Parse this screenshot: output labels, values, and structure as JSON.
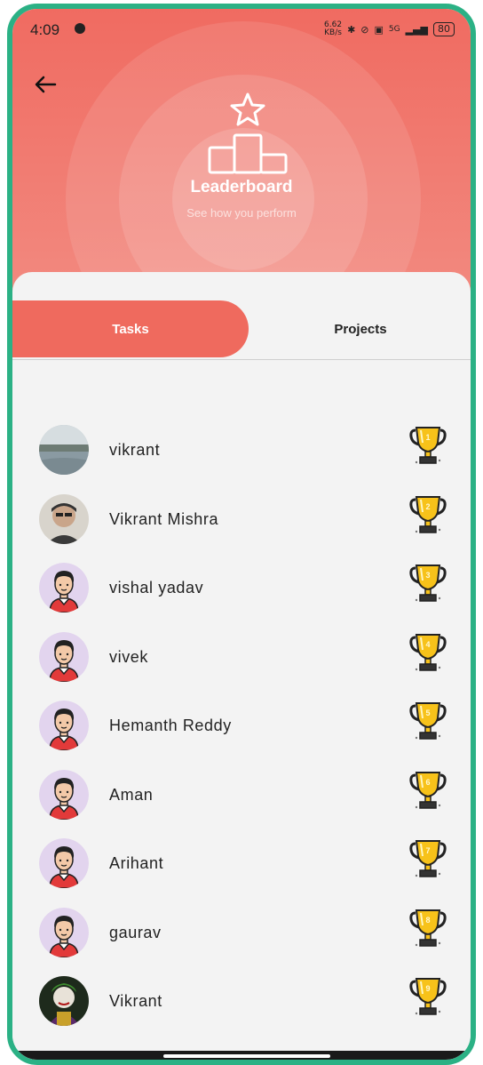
{
  "status_bar": {
    "time": "4:09",
    "speed": "6.62",
    "speed_unit": "KB/s",
    "network": "5G",
    "battery": "80"
  },
  "header": {
    "title": "Leaderboard",
    "subtitle": "See how you perform",
    "accent_color": "#f06b61"
  },
  "tabs": {
    "items": [
      {
        "label": "Tasks",
        "active": true
      },
      {
        "label": "Projects",
        "active": false
      }
    ]
  },
  "leaderboard": {
    "entries": [
      {
        "name": "vikrant",
        "rank": "1",
        "avatar": "photo-lake"
      },
      {
        "name": "Vikrant Mishra",
        "rank": "2",
        "avatar": "photo-person"
      },
      {
        "name": "vishal yadav",
        "rank": "3",
        "avatar": "default-avatar"
      },
      {
        "name": "vivek",
        "rank": "4",
        "avatar": "default-avatar"
      },
      {
        "name": "Hemanth Reddy",
        "rank": "5",
        "avatar": "default-avatar"
      },
      {
        "name": "Aman",
        "rank": "6",
        "avatar": "default-avatar"
      },
      {
        "name": "Arihant",
        "rank": "7",
        "avatar": "default-avatar"
      },
      {
        "name": "gaurav",
        "rank": "8",
        "avatar": "default-avatar"
      },
      {
        "name": "Vikrant",
        "rank": "9",
        "avatar": "photo-joker"
      }
    ]
  }
}
